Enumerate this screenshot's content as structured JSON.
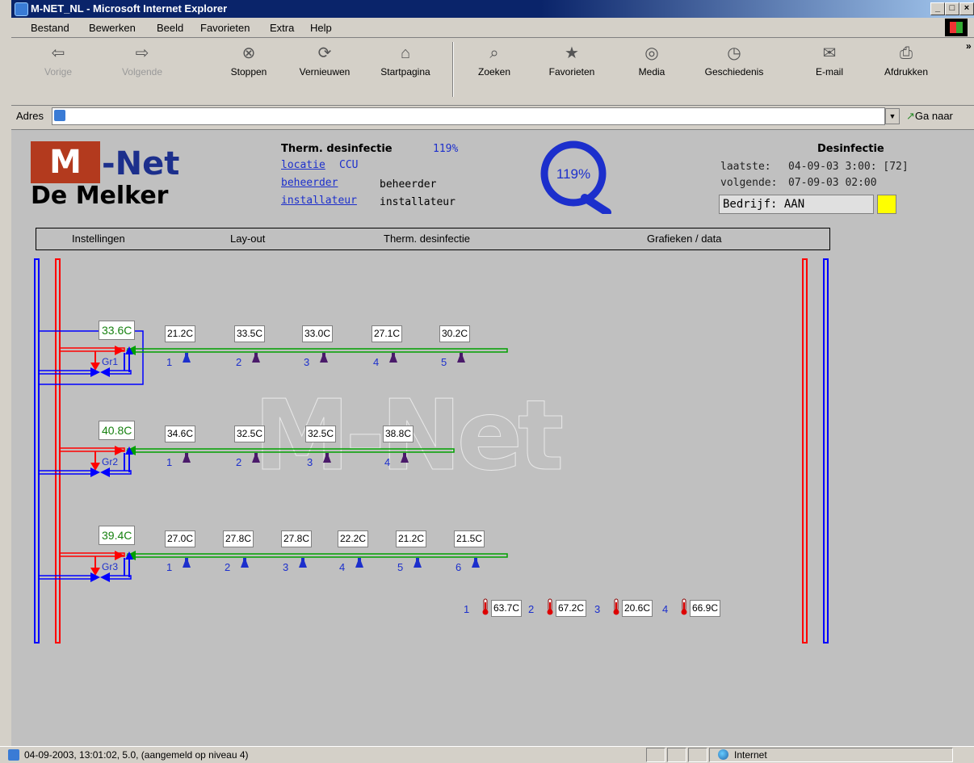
{
  "window": {
    "title": "M-NET_NL - Microsoft Internet Explorer"
  },
  "menu": [
    "Bestand",
    "Bewerken",
    "Beeld",
    "Favorieten",
    "Extra",
    "Help"
  ],
  "toolbar": {
    "back": "Vorige",
    "forward": "Volgende",
    "stop": "Stoppen",
    "refresh": "Vernieuwen",
    "home": "Startpagina",
    "search": "Zoeken",
    "favorites": "Favorieten",
    "media": "Media",
    "history": "Geschiedenis",
    "mail": "E-mail",
    "print": "Afdrukken"
  },
  "address": {
    "label": "Adres",
    "value": "",
    "go": "Ga naar"
  },
  "logo": {
    "mark": "M",
    "name": "-Net",
    "sub": "De Melker"
  },
  "header": {
    "title": "Therm. desinfectie",
    "percent": "119%",
    "locatie_link": "locatie",
    "locatie_value": "CCU",
    "beheerder_link": "beheerder",
    "beheerder_value": "beheerder",
    "installateur_link": "installateur",
    "installateur_value": "installateur",
    "gauge_value": "119%"
  },
  "desinfectie": {
    "title": "Desinfectie",
    "laatste_label": "laatste:",
    "laatste_value": "04-09-03 3:00: [72]",
    "volgende_label": "volgende:",
    "volgende_value": "07-09-03 02:00",
    "bedrijf": "Bedrijf: AAN"
  },
  "nav": [
    "Instellingen",
    "Lay-out",
    "Therm. desinfectie",
    "Grafieken / data"
  ],
  "groups": [
    {
      "label": "Gr1",
      "temp": "33.6C",
      "taps": [
        {
          "n": "1",
          "t": "21.2C"
        },
        {
          "n": "2",
          "t": "33.5C"
        },
        {
          "n": "3",
          "t": "33.0C"
        },
        {
          "n": "4",
          "t": "27.1C"
        },
        {
          "n": "5",
          "t": "30.2C"
        }
      ]
    },
    {
      "label": "Gr2",
      "temp": "40.8C",
      "taps": [
        {
          "n": "1",
          "t": "34.6C"
        },
        {
          "n": "2",
          "t": "32.5C"
        },
        {
          "n": "3",
          "t": "32.5C"
        },
        {
          "n": "4",
          "t": "38.8C"
        }
      ]
    },
    {
      "label": "Gr3",
      "temp": "39.4C",
      "taps": [
        {
          "n": "1",
          "t": "27.0C"
        },
        {
          "n": "2",
          "t": "27.8C"
        },
        {
          "n": "3",
          "t": "27.8C"
        },
        {
          "n": "4",
          "t": "22.2C"
        },
        {
          "n": "5",
          "t": "21.2C"
        },
        {
          "n": "6",
          "t": "21.5C"
        }
      ]
    }
  ],
  "boilers": [
    {
      "n": "1",
      "t": "63.7C"
    },
    {
      "n": "2",
      "t": "67.2C"
    },
    {
      "n": "3",
      "t": "20.6C"
    },
    {
      "n": "4",
      "t": "66.9C"
    }
  ],
  "status": {
    "text": "04-09-2003, 13:01:02, 5.0, (aangemeld op niveau 4)",
    "zone": "Internet"
  },
  "colors": {
    "hot": "#ff0000",
    "cold": "#0000ff",
    "circulation": "#00a000",
    "titlebar": "#0a246a"
  }
}
